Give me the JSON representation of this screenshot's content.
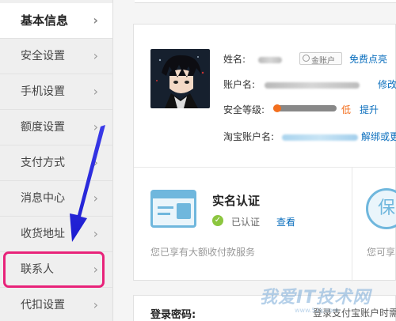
{
  "sidebar": {
    "items": [
      {
        "label": "基本信息"
      },
      {
        "label": "安全设置"
      },
      {
        "label": "手机设置"
      },
      {
        "label": "额度设置"
      },
      {
        "label": "支付方式"
      },
      {
        "label": "消息中心"
      },
      {
        "label": "收货地址"
      },
      {
        "label": "联系人"
      },
      {
        "label": "代扣设置"
      }
    ],
    "chevron": "›"
  },
  "profile": {
    "name_label": "姓名:",
    "badge": "金账户",
    "free_link": "免费点亮",
    "account_label": "账户名:",
    "account_link": "修改",
    "security_label": "安全等级:",
    "security_level": "低",
    "security_progress": 0.1,
    "upgrade_link": "提升",
    "taobao_label": "淘宝账户名:",
    "taobao_link": "解绑或更"
  },
  "realname": {
    "title": "实名认证",
    "status": "已认证",
    "view_link": "查看",
    "desc": "您已享有大额收付款服务",
    "seal_char": "保",
    "desc2": "您可享"
  },
  "password": {
    "label": "登录密码:",
    "desc": "登录支付宝账户时需"
  },
  "watermark": {
    "text": "我爱IT技术网",
    "sub": "www.52ij.com"
  },
  "colors": {
    "highlight_border": "#e8237a",
    "arrow": "#2e2ee0",
    "link": "#0a6ebd",
    "low": "#f36f1e"
  }
}
